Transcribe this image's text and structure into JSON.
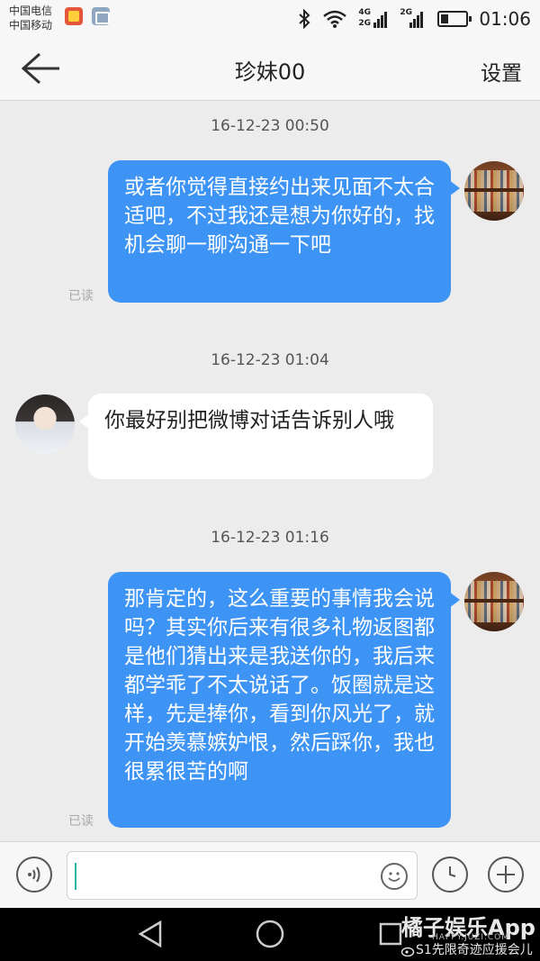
{
  "status_bar": {
    "carrier_1": "中国电信",
    "carrier_2": "中国移动",
    "net_top": "4G",
    "net_bottom": "2G",
    "net_2g": "2G",
    "battery_level": 0.3,
    "time": "01:06"
  },
  "nav": {
    "back_icon": "arrow-left",
    "title": "珍妹00",
    "settings_label": "设置"
  },
  "chat": {
    "messages": [
      {
        "timestamp": "16-12-23 00:50",
        "direction": "out",
        "text": "或者你觉得直接约出来见面不太合适吧，不过我还是想为你好的，找机会聊一聊沟通一下吧",
        "status": "已读"
      },
      {
        "timestamp": "16-12-23 01:04",
        "direction": "in",
        "text": "你最好别把微博对话告诉别人哦"
      },
      {
        "timestamp": "16-12-23 01:16",
        "direction": "out",
        "text": "那肯定的，这么重要的事情我会说吗？其实你后来有很多礼物返图都是他们猜出来是我送你的，我后来都学乖了不太说话了。饭圈就是这样，先是捧你，看到你风光了，就开始羡慕嫉妒恨，然后踩你，我也很累很苦的啊",
        "status": "已读"
      }
    ]
  },
  "input_bar": {
    "voice_icon": "voice-wave",
    "text_value": "",
    "emoji_icon": "smiley",
    "clock_icon": "clock",
    "plus_icon": "plus"
  },
  "watermark": {
    "brand": "橘子娱乐App",
    "url": "HAPPY.JUZI.COM",
    "weibo": "S1先限奇迹应援会儿"
  }
}
